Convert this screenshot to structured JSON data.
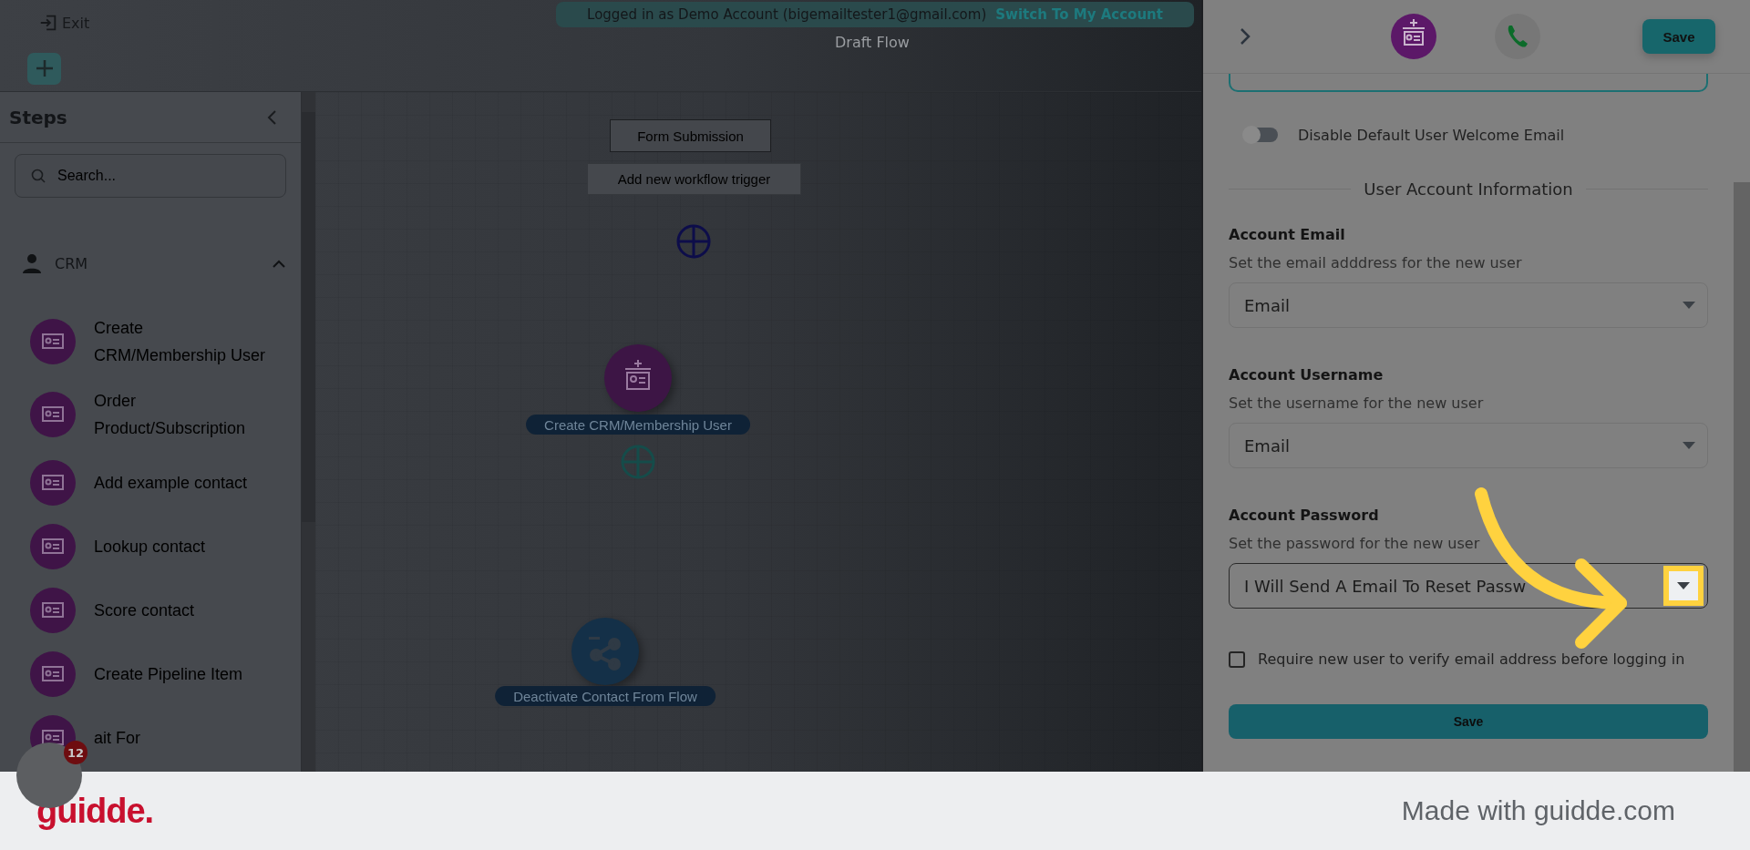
{
  "top_bar": {
    "exit_label": "Exit"
  },
  "banner": {
    "text": "Logged in as Demo Account (bigemailtester1@gmail.com)",
    "link": "Switch To My Account"
  },
  "sidebar": {
    "title": "Steps",
    "search_placeholder": "Search...",
    "group": {
      "label": "CRM",
      "expanded": true
    },
    "items": [
      {
        "label": "Create CRM/Membership User"
      },
      {
        "label": "Order Product/Subscription"
      },
      {
        "label": "Add example contact"
      },
      {
        "label": "Lookup contact"
      },
      {
        "label": "Score contact"
      },
      {
        "label": "Create Pipeline Item"
      },
      {
        "label": "ait For"
      }
    ]
  },
  "canvas": {
    "title": "Draft Flow",
    "trigger": "Form Submission",
    "add_trigger": "Add new workflow trigger",
    "nodes": [
      {
        "kind": "crm",
        "label": "Create CRM/Membership User"
      },
      {
        "kind": "share",
        "label": "Deactivate Contact From Flow"
      }
    ]
  },
  "chat_widget": {
    "badge": "12"
  },
  "panel": {
    "save": "Save",
    "welcome_toggle": {
      "label": "Disable Default User Welcome Email",
      "on": false
    },
    "section_title": "User Account Information",
    "fields": [
      {
        "label": "Account Email",
        "description": "Set the email adddress for the new user",
        "value": "Email",
        "highlighted": false
      },
      {
        "label": "Account Username",
        "description": "Set the username for the new user",
        "value": "Email",
        "highlighted": false
      },
      {
        "label": "Account Password",
        "description": "Set the password for the new user",
        "value": "I Will Send A Email To Reset Passw",
        "highlighted": true
      }
    ],
    "verify": {
      "label": "Require new user to verify email address before logging in",
      "checked": false
    },
    "submit": "Save"
  },
  "footer": {
    "logo": "guidde.",
    "tagline": "Made with guidde.com"
  }
}
